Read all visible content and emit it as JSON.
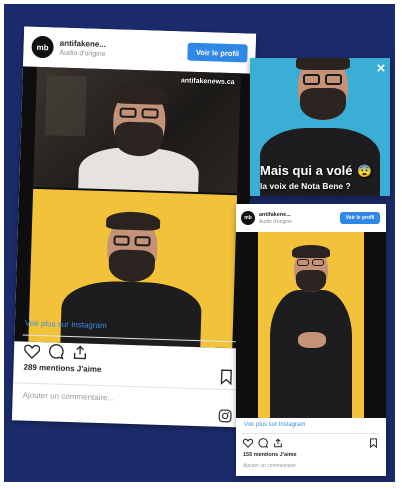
{
  "embed_left": {
    "username": "antifakene...",
    "subtitle": "Audio d'origine",
    "avatar_text": "mb",
    "follow_label": "Voir le profil",
    "watermark": "antifakenews.ca",
    "view_more": "Voir plus sur Instagram",
    "likes": "289 mentions J'aime",
    "comment_placeholder": "Ajouter un commentaire..."
  },
  "video_card": {
    "caption_line1": "Mais qui a volé",
    "caption_line2": "la voix de Nota Bene ?",
    "emoji": "😨"
  },
  "embed_right": {
    "username": "antifakene...",
    "subtitle": "Audio d'origine",
    "avatar_text": "mb",
    "follow_label": "Voir le profil",
    "view_more": "Voir plus sur Instagram",
    "likes": "155 mentions J'aime",
    "comment_placeholder": "Ajouter un commentaire"
  },
  "colors": {
    "background": "#1c2b6b",
    "accent": "#2f88e6",
    "teal": "#3aaed4",
    "yellow": "#f2c23a"
  },
  "icons": [
    "heart-icon",
    "comment-icon",
    "share-icon",
    "bookmark-icon",
    "instagram-icon",
    "close-icon"
  ]
}
